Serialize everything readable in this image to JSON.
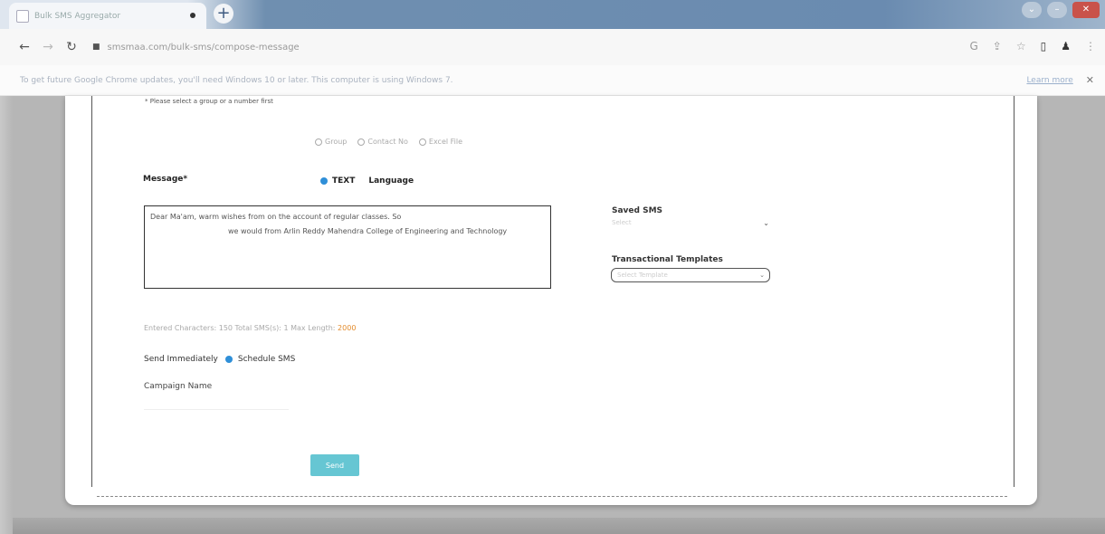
{
  "browser": {
    "tab_title": "Bulk SMS Aggregator",
    "new_tab": "+",
    "url": "smsmaa.com/bulk-sms/compose-message",
    "infobar_text": "To get future Google Chrome updates, you'll need Windows 10 or later. This computer is using Windows 7.",
    "learn_more": "Learn more",
    "dismiss": "✕"
  },
  "form": {
    "top_note": "* Please select a group or a number first",
    "recipient_options": [
      "Group",
      "Contact No",
      "Excel File"
    ],
    "message_label": "Message",
    "message_label_required": "*",
    "message_types": [
      "TEXT",
      "Language"
    ],
    "message_line1": "Dear Ma'am, warm wishes from                    on the account of regular classes. So",
    "message_line2": "we would from Arlin Reddy Mahendra College of Engineering and Technology",
    "saved_sms_label": "Saved SMS",
    "saved_sms_placeholder": "Select",
    "transactional_label": "Transactional Templates",
    "transactional_placeholder": "Select Template",
    "counter_text": "Entered Characters: 150 Total SMS(s): 1 Max Length:",
    "counter_max": "2000",
    "send_immediately": "Send Immediately",
    "schedule_sms": "Schedule SMS",
    "campaign_label": "Campaign Name",
    "send_button": "Send"
  },
  "colors": {
    "accent_radio": "#2f8fd8",
    "send_button": "#66c6d3",
    "max_length": "#e38b2c"
  }
}
